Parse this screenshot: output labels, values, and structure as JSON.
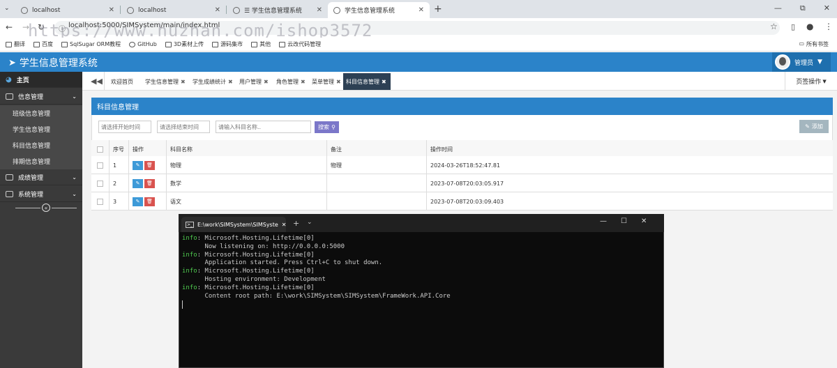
{
  "browser": {
    "tabs": [
      {
        "label": "localhost",
        "active": false
      },
      {
        "label": "localhost",
        "active": false
      },
      {
        "label": "☰ 学生信息管理系统",
        "active": false
      },
      {
        "label": "学生信息管理系统",
        "active": true
      }
    ],
    "url": "localhost:5000/SIMSystem/main/index.html",
    "watermark": "https://www.huzhan.com/ishop3572",
    "bookmarks": [
      "翻译",
      "百度",
      "SqlSugar ORM教程",
      "GitHub",
      "3D素材上传",
      "源码集市",
      "其他",
      "云改代码管理"
    ],
    "all_bookmarks": "所有书签"
  },
  "app": {
    "title": "学生信息管理系统",
    "user": "管理员",
    "accent": "#2b83c9"
  },
  "sidebar": {
    "home": "主页",
    "groups": [
      {
        "label": "信息管理",
        "icon": "info-icon"
      },
      {
        "label": "成绩管理",
        "icon": "image-icon"
      },
      {
        "label": "系统管理",
        "icon": "list-icon"
      }
    ],
    "sub_items": [
      "班级信息管理",
      "学生信息管理",
      "科目信息管理",
      "排期信息管理"
    ]
  },
  "content_tabs": [
    "欢迎首页",
    "学生信息管理",
    "学生成绩统计",
    "用户管理",
    "角色管理",
    "菜单管理",
    "科目信息管理"
  ],
  "page_options": "页签操作",
  "panel": {
    "title": "科目信息管理",
    "start_placeholder": "请选择开始时间",
    "end_placeholder": "请选择结束时间",
    "name_placeholder": "请输入科目名称..",
    "search_label": "搜索",
    "add_label": "添加"
  },
  "table": {
    "headers": [
      "序号",
      "操作",
      "科目名称",
      "备注",
      "操作时间"
    ],
    "rows": [
      {
        "no": "1",
        "name": "物理",
        "remark": "物理",
        "time": "2024-03-26T18:52:47.81"
      },
      {
        "no": "2",
        "name": "数学",
        "remark": "",
        "time": "2023-07-08T20:03:05.917"
      },
      {
        "no": "3",
        "name": "语文",
        "remark": "",
        "time": "2023-07-08T20:03:09.403"
      }
    ]
  },
  "terminal": {
    "title": "E:\\work\\SIMSystem\\SIMSyste",
    "lines": [
      {
        "prefix": "info",
        "text": ": Microsoft.Hosting.Lifetime[0]"
      },
      {
        "prefix": "",
        "text": "      Now listening on: http://0.0.0.0:5000"
      },
      {
        "prefix": "info",
        "text": ": Microsoft.Hosting.Lifetime[0]"
      },
      {
        "prefix": "",
        "text": "      Application started. Press Ctrl+C to shut down."
      },
      {
        "prefix": "info",
        "text": ": Microsoft.Hosting.Lifetime[0]"
      },
      {
        "prefix": "",
        "text": "      Hosting environment: Development"
      },
      {
        "prefix": "info",
        "text": ": Microsoft.Hosting.Lifetime[0]"
      },
      {
        "prefix": "",
        "text": "      Content root path: E:\\work\\SIMSystem\\SIMSystem\\FrameWork.API.Core"
      }
    ]
  }
}
